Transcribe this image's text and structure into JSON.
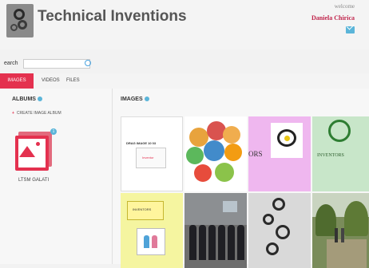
{
  "header": {
    "title": "Technical Inventions",
    "welcome": "welcome",
    "username": "Daniela Chirica"
  },
  "search": {
    "label": "earch",
    "placeholder": ""
  },
  "tabs": [
    {
      "label": "IMAGES",
      "active": true
    },
    {
      "label": "VIDEOS",
      "active": false
    },
    {
      "label": "FILES",
      "active": false
    }
  ],
  "sidebar": {
    "heading": "ALBUMS",
    "create_label": "CREATE IMAGE ALBUM",
    "albums": [
      {
        "name": "LTSM GALATI",
        "count": "1"
      }
    ]
  },
  "main": {
    "heading": "IMAGES",
    "thumbs": [
      {
        "caption": "DRAG IMAGE 10 03",
        "inner_text": "Inventor"
      },
      {
        "caption": ""
      },
      {
        "caption": "ORS"
      },
      {
        "caption": "INVENTORS"
      },
      {
        "caption": "INVENTORS"
      },
      {
        "caption": ""
      },
      {
        "caption": ""
      },
      {
        "caption": ""
      }
    ]
  },
  "colors": {
    "accent": "#e4314f",
    "info": "#5bb5d9"
  }
}
